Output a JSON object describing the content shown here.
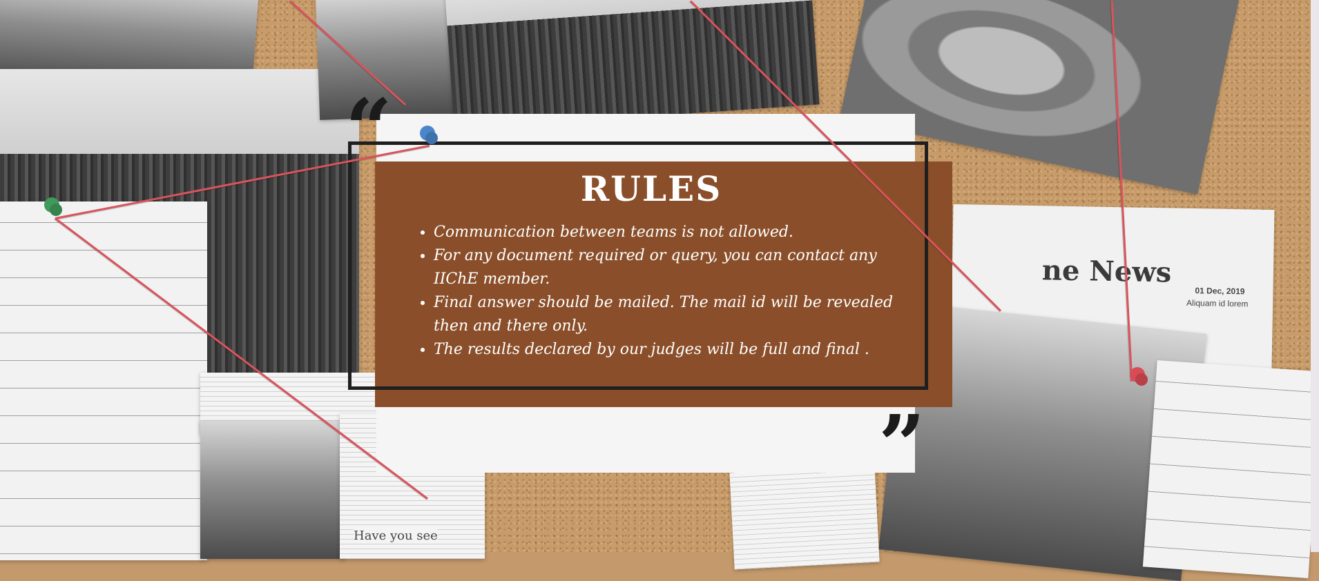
{
  "rules": {
    "title": "RULES",
    "items": [
      "Communication between teams is not allowed.",
      "For any document required or query, you can contact any IIChE member.",
      "Final answer should be mailed. The mail id will be revealed then and there only.",
      "The results declared by our judges will be full and final ."
    ]
  },
  "quotes": {
    "open": "“",
    "close": "”"
  },
  "background": {
    "newspaper_headline": "ne News",
    "newspaper_date": "01 Dec, 2019",
    "newspaper_sub": "Aliquam id lorem",
    "newsprint_caption": "Have you see"
  },
  "colors": {
    "panel_brown": "#8a4f2a",
    "frame": "#1f1f1f",
    "string_red": "#d9545c",
    "pin_blue": "#4a86c9",
    "pin_green": "#3f9a5c",
    "pin_red": "#d94b55"
  }
}
